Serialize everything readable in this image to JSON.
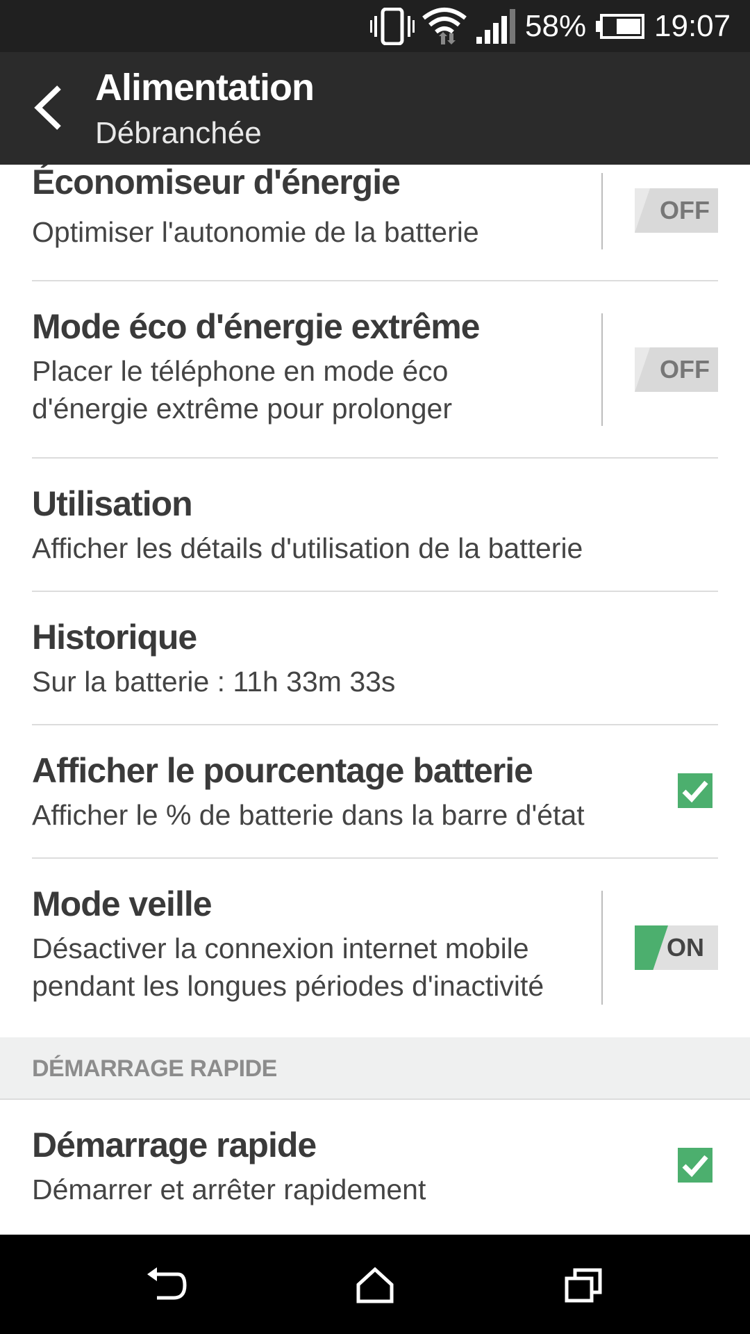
{
  "status_bar": {
    "battery_percent": "58%",
    "time": "19:07",
    "icons": [
      "vibrate-icon",
      "wifi-icon",
      "signal-icon",
      "battery-icon"
    ]
  },
  "app_bar": {
    "title": "Alimentation",
    "subtitle": "Débranchée"
  },
  "settings": [
    {
      "title": "Économiseur d'énergie",
      "description": "Optimiser l'autonomie de la batterie",
      "control": "toggle",
      "toggle_label": "OFF",
      "state": "off"
    },
    {
      "title": "Mode éco d'énergie extrême",
      "description_lines": [
        "Placer le téléphone en mode éco",
        "d'énergie extrême pour prolonger"
      ],
      "control": "toggle",
      "toggle_label": "OFF",
      "state": "off"
    },
    {
      "title": "Utilisation",
      "description": "Afficher les détails d'utilisation de la batterie"
    },
    {
      "title": "Historique",
      "description": "Sur la batterie : 11h 33m 33s"
    },
    {
      "title": "Afficher le pourcentage batterie",
      "description": "Afficher le % de batterie dans la barre d'état",
      "control": "checkbox",
      "checked": true
    },
    {
      "title": "Mode veille",
      "description_lines": [
        "Désactiver la connexion internet mobile",
        "pendant les longues périodes d'inactivité"
      ],
      "control": "toggle",
      "toggle_label": "ON",
      "state": "on"
    }
  ],
  "section_header": "DÉMARRAGE RAPIDE",
  "quick_start": {
    "title": "Démarrage rapide",
    "description": "Démarrer et arrêter rapidement",
    "checked": true
  },
  "colors": {
    "accent_green": "#4caf6e",
    "app_bar": "#2b2b2b",
    "status_bar": "#202020"
  }
}
